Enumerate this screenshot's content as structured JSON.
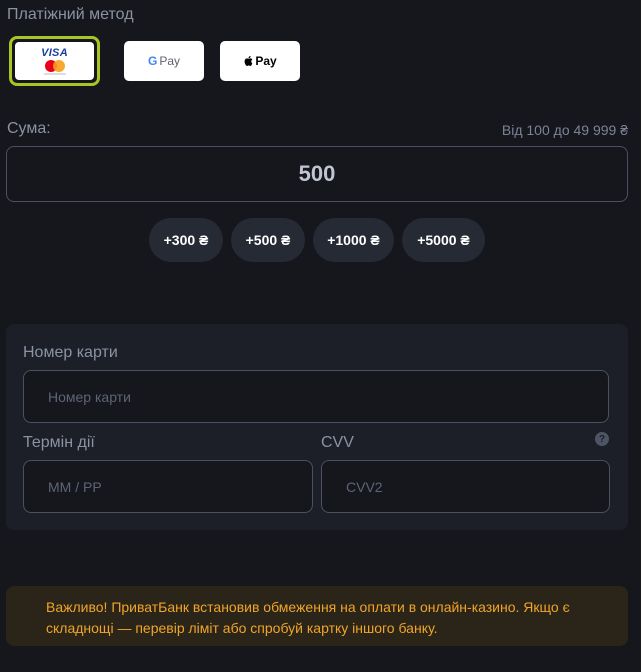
{
  "payment_method": {
    "title": "Платіжний метод",
    "options": [
      {
        "id": "card",
        "label_top": "VISA",
        "selected": true
      },
      {
        "id": "gpay",
        "label": "Pay"
      },
      {
        "id": "apay",
        "label": "Pay"
      }
    ]
  },
  "amount": {
    "label": "Сума:",
    "range": "Від 100 до 49 999 ₴",
    "value": "500",
    "quick_add": [
      "+300 ₴",
      "+500 ₴",
      "+1000 ₴",
      "+5000 ₴"
    ]
  },
  "card_form": {
    "card_number_label": "Номер карти",
    "card_number_placeholder": "Номер карти",
    "expiry_label": "Термін дії",
    "expiry_placeholder": "MM / PP",
    "cvv_label": "CVV",
    "cvv_placeholder": "CVV2",
    "help_icon": "?"
  },
  "warning": {
    "text": "Важливо! ПриватБанк встановив обмеження на оплати в онлайн-казино. Якщо є складнощі — перевір ліміт або спробуй картку іншого банку."
  },
  "colors": {
    "background": "#15171d",
    "selected_border": "#a8c621",
    "warning_text": "#f0a52a",
    "panel": "#1c1f28"
  }
}
